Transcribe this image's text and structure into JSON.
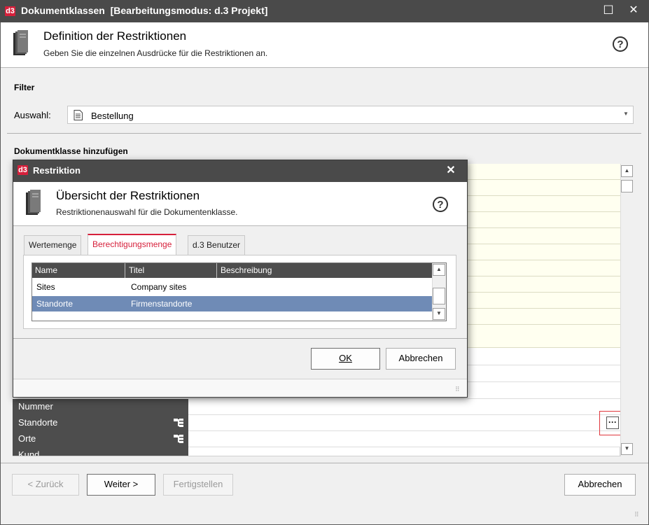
{
  "window": {
    "title": "Dokumentklassen",
    "mode": "[Bearbeitungsmodus: d.3 Projekt]",
    "logo": "d3",
    "maximize_glyph": "☐",
    "close_glyph": "✕"
  },
  "header": {
    "title": "Definition der Restriktionen",
    "subtitle": "Geben Sie die einzelnen Ausdrücke für die Restriktionen an.",
    "help_glyph": "?"
  },
  "filter": {
    "section_label": "Filter",
    "select_label": "Auswahl:",
    "selected_value": "Bestellung"
  },
  "doc_class": {
    "section_label": "Dokumentklasse hinzufügen",
    "property_rows": [
      {
        "label": "Nummer"
      },
      {
        "label": "Standorte"
      },
      {
        "label": "Orte"
      },
      {
        "label": "Kund"
      }
    ],
    "ellipsis_label": "···"
  },
  "footer": {
    "back_label": "< Zurück",
    "next_label": "Weiter >",
    "finish_label": "Fertigstellen",
    "cancel_label": "Abbrechen"
  },
  "dialog": {
    "logo": "d3",
    "title": "Restriktion",
    "close_glyph": "✕",
    "header_title": "Übersicht der Restriktionen",
    "header_subtitle": "Restriktionenauswahl für die Dokumentenklasse.",
    "help_glyph": "?",
    "tabs": [
      {
        "label": "Wertemenge"
      },
      {
        "label": "Berechtigungsmenge"
      },
      {
        "label": "d.3 Benutzer"
      }
    ],
    "columns": {
      "name": "Name",
      "title": "Titel",
      "description": "Beschreibung"
    },
    "rows": [
      {
        "name": "Sites",
        "title": "Company sites",
        "description": ""
      },
      {
        "name": "Standorte",
        "title": "Firmenstandorte",
        "description": ""
      }
    ],
    "ok_label": "OK",
    "cancel_label": "Abbrechen"
  },
  "colors": {
    "accent": "#d6203b",
    "titlebar": "#4a4a4a",
    "selection": "#6f8bb6",
    "grid_yellow": "#fffff0",
    "highlight_box": "#e0363c"
  }
}
